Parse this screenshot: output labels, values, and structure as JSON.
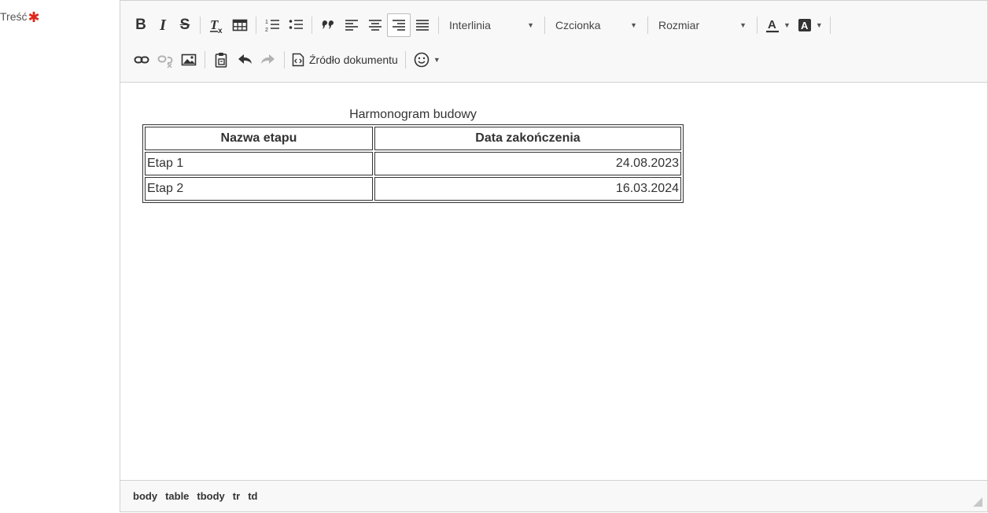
{
  "field": {
    "label": "Treść",
    "required_mark": "✱"
  },
  "toolbar": {
    "bold": "B",
    "italic": "I",
    "strike": "S",
    "line_height_label": "Interlinia",
    "font_label": "Czcionka",
    "size_label": "Rozmiar",
    "source_label": "Źródło dokumentu",
    "active_button": "align-right"
  },
  "document": {
    "caption": "Harmonogram budowy",
    "headers": [
      "Nazwa etapu",
      "Data zakończenia"
    ],
    "rows": [
      [
        "Etap 1",
        "24.08.2023"
      ],
      [
        "Etap 2",
        "16.03.2024"
      ]
    ]
  },
  "statusbar": {
    "path": [
      "body",
      "table",
      "tbody",
      "tr",
      "td"
    ]
  },
  "colors": {
    "required": "#e0261b",
    "toolbar_bg": "#f8f8f8",
    "border": "#d1d1d1"
  }
}
